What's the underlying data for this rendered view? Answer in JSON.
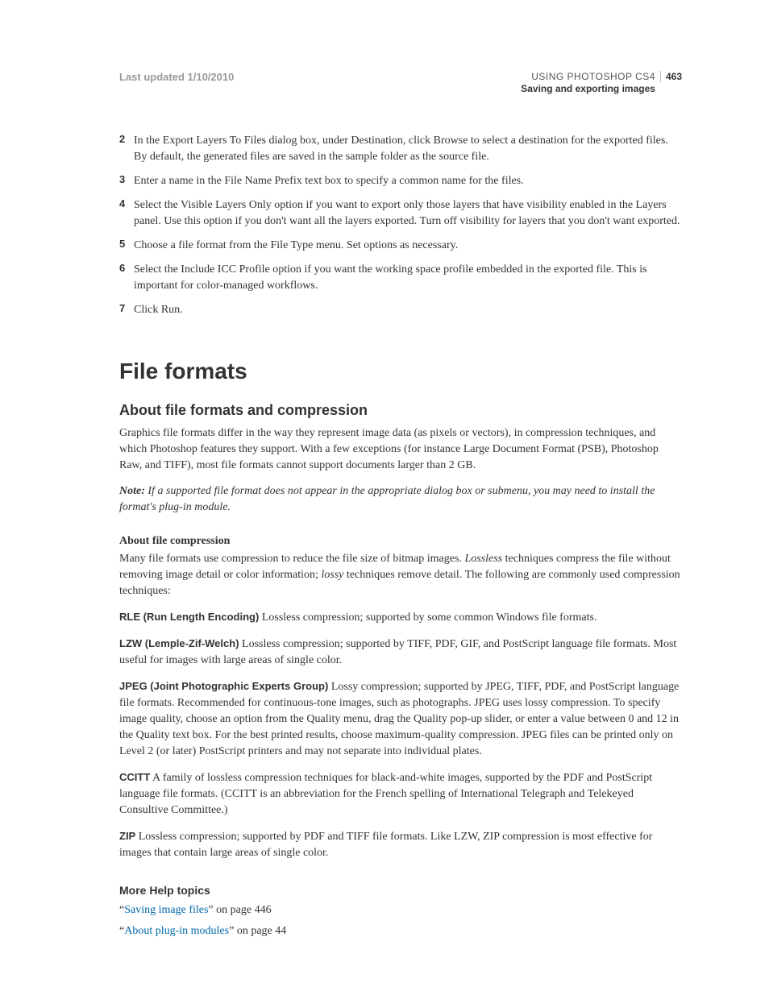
{
  "header": {
    "last_updated": "Last updated 1/10/2010",
    "running_head": "USING PHOTOSHOP CS4",
    "chapter": "Saving and exporting images",
    "page_number": "463"
  },
  "steps": [
    {
      "num": "2",
      "text": "In the Export Layers To Files dialog box, under Destination, click Browse to select a destination for the exported files. By default, the generated files are saved in the sample folder as the source file."
    },
    {
      "num": "3",
      "text": "Enter a name in the File Name Prefix text box to specify a common name for the files."
    },
    {
      "num": "4",
      "text": "Select the Visible Layers Only option if you want to export only those layers that have visibility enabled in the Layers panel. Use this option if you don't want all the layers exported. Turn off visibility for layers that you don't want exported."
    },
    {
      "num": "5",
      "text": "Choose a file format from the File Type menu. Set options as necessary."
    },
    {
      "num": "6",
      "text": "Select the Include ICC Profile option if you want the working space profile embedded in the exported file. This is important for color-managed workflows."
    },
    {
      "num": "7",
      "text": "Click Run."
    }
  ],
  "section": {
    "title": "File formats",
    "subtitle": "About file formats and compression",
    "intro": "Graphics file formats differ in the way they represent image data (as pixels or vectors), in compression techniques, and which Photoshop features they support. With a few exceptions (for instance Large Document Format (PSB), Photoshop Raw, and TIFF), most file formats cannot support documents larger than 2 GB.",
    "note_label": "Note:",
    "note_text": " If a supported file format does not appear in the appropriate dialog box or submenu, you may need to install the format's plug-in module.",
    "compression_heading": "About file compression",
    "compression_intro_1": "Many file formats use compression to reduce the file size of bitmap images. ",
    "lossless_word": "Lossless",
    "compression_intro_2": " techniques compress the file without removing image detail or color information; ",
    "lossy_word": "lossy",
    "compression_intro_3": " techniques remove detail. The following are commonly used compression techniques:",
    "terms": {
      "rle_label": "RLE (Run Length Encoding)",
      "rle_desc": "  Lossless compression; supported by some common Windows file formats.",
      "lzw_label": "LZW (Lemple-Zif-Welch)",
      "lzw_desc": "  Lossless compression; supported by TIFF, PDF, GIF, and PostScript language file formats. Most useful for images with large areas of single color.",
      "jpeg_label": "JPEG (Joint Photographic Experts Group)",
      "jpeg_desc": "  Lossy compression; supported by JPEG, TIFF, PDF, and PostScript language file formats. Recommended for continuous-tone images, such as photographs. JPEG uses lossy compression. To specify image quality, choose an option from the Quality menu, drag the Quality pop-up slider, or enter a value between 0 and 12 in the Quality text box. For the best printed results, choose maximum-quality compression. JPEG files can be printed only on Level 2 (or later) PostScript printers and may not separate into individual plates.",
      "ccitt_label": "CCITT",
      "ccitt_desc": "  A family of lossless compression techniques for black-and-white images, supported by the PDF and PostScript language file formats. (CCITT is an abbreviation for the French spelling of International Telegraph and Telekeyed Consultive Committee.)",
      "zip_label": "ZIP",
      "zip_desc": "  Lossless compression; supported by PDF and TIFF file formats. Like LZW, ZIP compression is most effective for images that contain large areas of single color."
    },
    "more_help_heading": "More Help topics",
    "help_links": {
      "l1_q1": "“",
      "l1_text": "Saving image files",
      "l1_rest": "” on page 446",
      "l2_q1": "“",
      "l2_text": "About plug-in modules",
      "l2_rest": "” on page 44"
    }
  }
}
